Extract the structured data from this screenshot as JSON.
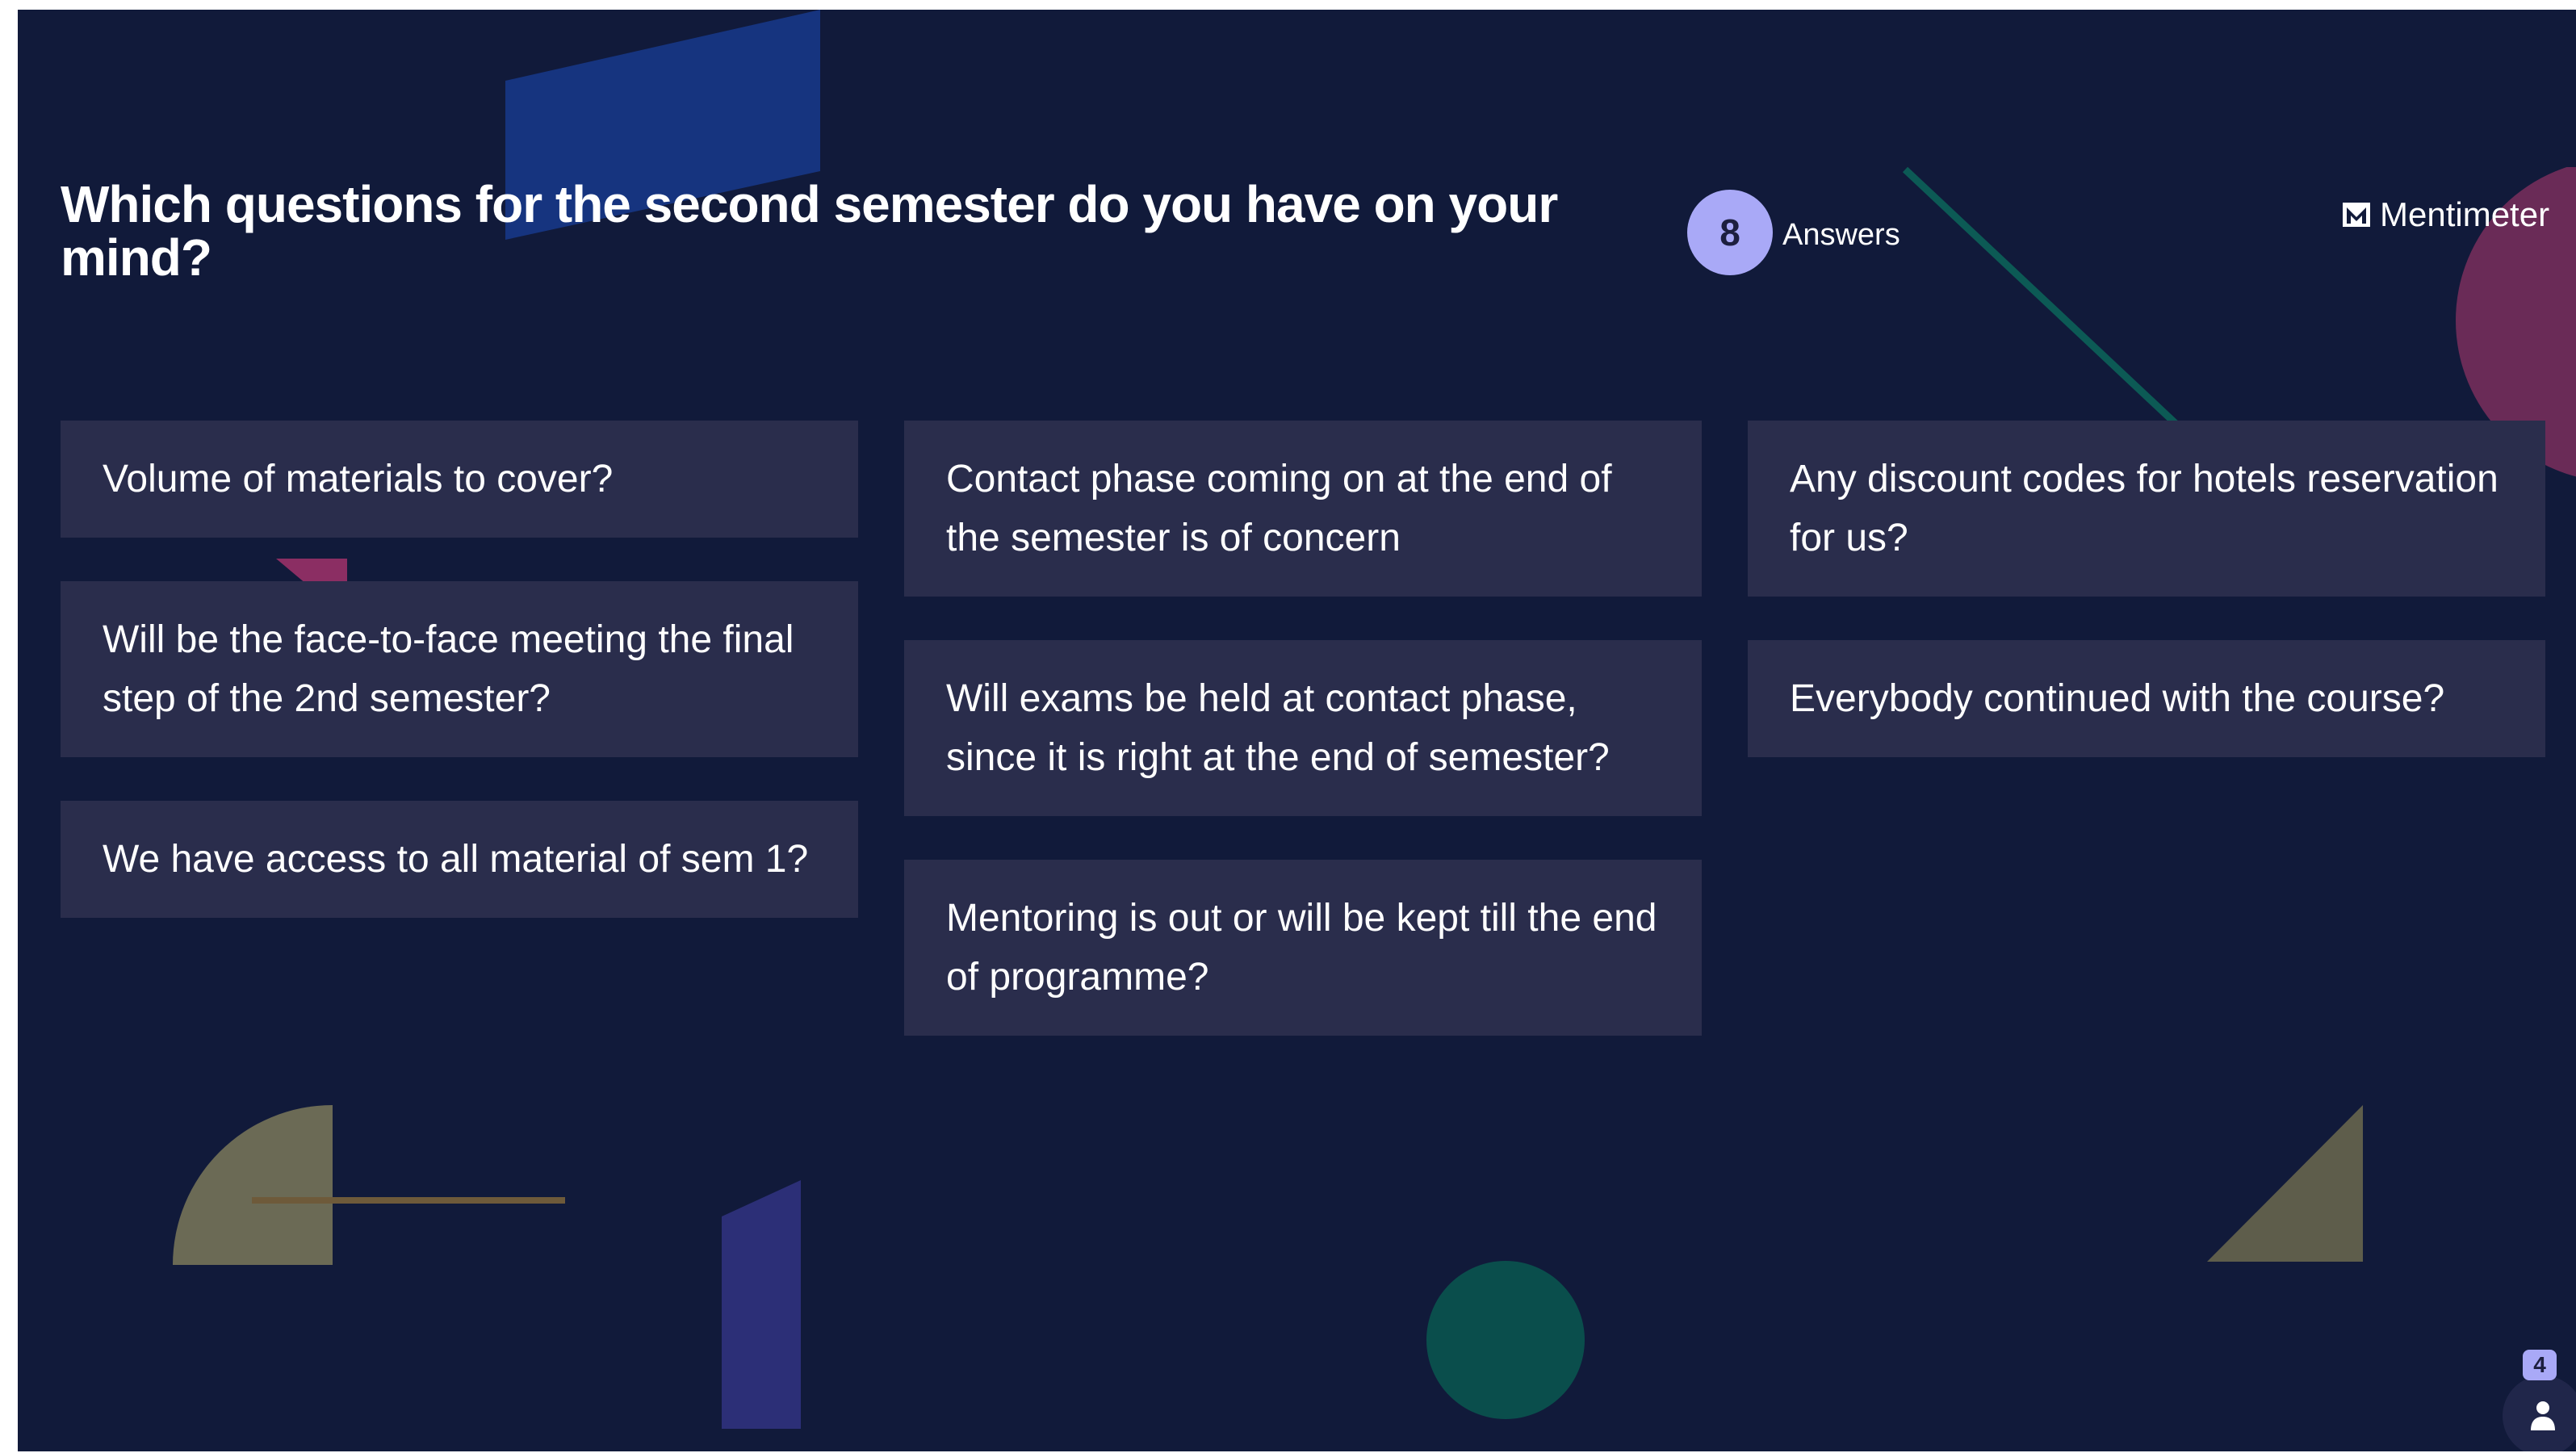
{
  "question": {
    "title": "Which questions for the second semester do you have on your mind?"
  },
  "stats": {
    "answer_count": "8",
    "answers_label": "Answers"
  },
  "brand": {
    "name": "Mentimeter",
    "icon": "mentimeter-logo-icon"
  },
  "responses": {
    "col1": [
      "Volume of materials to cover?",
      "Will be the face-to-face meeting the final step of the 2nd semester?",
      "We have access to all material of sem 1?"
    ],
    "col2": [
      "Contact phase coming on at the end of the semester is of concern",
      "Will exams be held at contact phase, since it is right at the end of semester?",
      "Mentoring is out or will be kept till the end of programme?"
    ],
    "col3": [
      "Any discount codes for hotels reservation for us?",
      "Everybody continued with the course?"
    ]
  },
  "participants": {
    "count": "4",
    "icon": "person-icon"
  },
  "colors": {
    "background": "#111a3a",
    "card": "#2a2d4c",
    "accent": "#a9a9f7",
    "text": "#ffffff"
  }
}
